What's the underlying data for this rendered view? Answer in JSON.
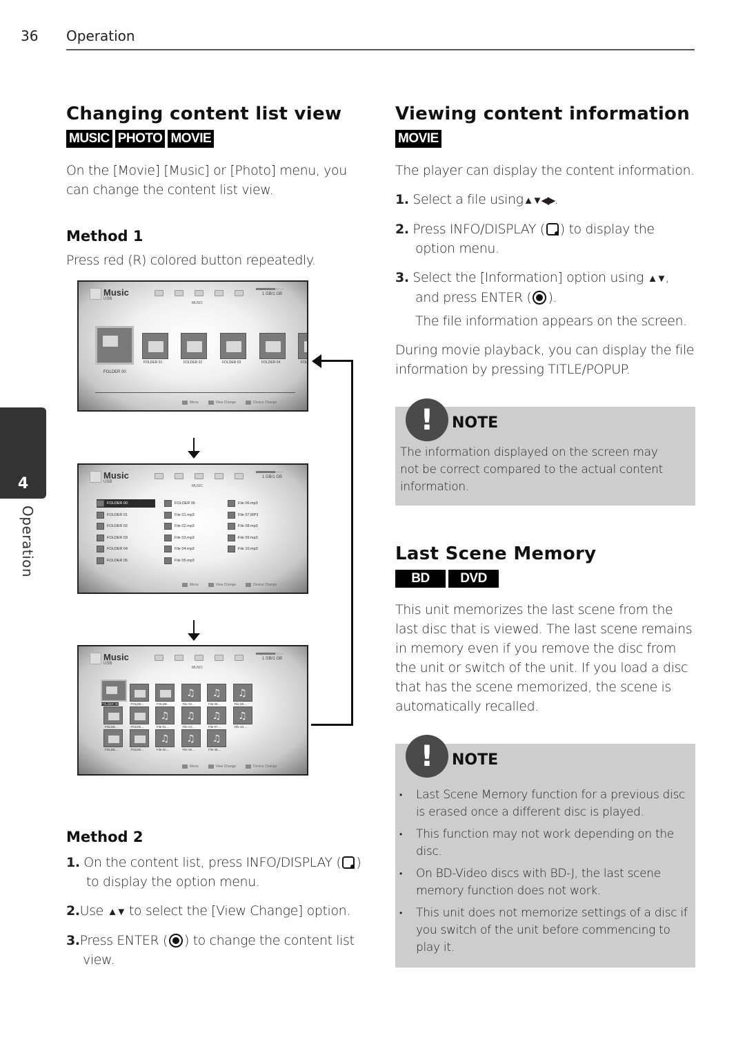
{
  "header": {
    "page_number": "36",
    "running_head": "Operation"
  },
  "side_tab": {
    "number": "4",
    "label": "Operation"
  },
  "left": {
    "title": "Changing content list view",
    "badges": [
      "MUSIC",
      "PHOTO",
      "MOVIE"
    ],
    "intro": "On the [Movie] [Music] or [Photo] menu, you can change the content list view.",
    "method1": {
      "heading": "Method 1",
      "text": "Press red (R) colored button repeatedly."
    },
    "screens": {
      "title": "Music",
      "subtitle": "USB",
      "tab_label": "MUSIC",
      "capacity": "1 GB/1 GB",
      "footer": [
        "Menu",
        "View Change",
        "Device Change"
      ],
      "screen1": {
        "tiles": [
          "FOLDER 00",
          "FOLDER 01",
          "FOLDER 02",
          "FOLDER 03",
          "FOLDER 04",
          "FOL"
        ]
      },
      "screen2": {
        "col1": [
          "FOLDER 00",
          "FOLDER 01",
          "FOLDER 02",
          "FOLDER 03",
          "FOLDER 04",
          "FOLDER 05"
        ],
        "col2": [
          "FOLDER 06",
          "File 01.mp3",
          "File 02.mp3",
          "File 03.mp3",
          "File 04.mp3",
          "File 05.mp3"
        ],
        "col3": [
          "File 06.mp3",
          "File 07.MP3",
          "File 08.mp3",
          "File 09.mp3",
          "File 10.mp3"
        ]
      },
      "screen3": {
        "row1": [
          "FOLDER 00",
          "FOLDE...",
          "FOLDE...",
          "File 03....",
          "File 06....",
          "File 09...."
        ],
        "row2": [
          "FOLDE...",
          "FOLDE...",
          "File 01....",
          "File 04....",
          "File 07....",
          "File 10...."
        ],
        "row3": [
          "FOLDE...",
          "FOLDE...",
          "File 02....",
          "File 05....",
          "File 08...."
        ]
      }
    },
    "method2": {
      "heading": "Method 2",
      "steps": [
        {
          "num": "1.",
          "pre": "On the content list, press INFO/DISPLAY (",
          "post": ")",
          "line2": "to display the option menu."
        },
        {
          "num": "2.",
          "pre": "Use ",
          "arrows": "▲▼",
          "post": " to select the [View Change] option."
        },
        {
          "num": "3.",
          "pre": "Press ENTER (",
          "post": ") to change the content list",
          "line2": "view."
        }
      ]
    }
  },
  "right": {
    "title": "Viewing content information",
    "badges": [
      "MOVIE"
    ],
    "intro": "The player can display the content information.",
    "steps": [
      {
        "num": "1.",
        "pre": "Select a file using",
        "arrows": "▲▼◀▶",
        "post": "."
      },
      {
        "num": "2.",
        "pre": "Press INFO/DISPLAY (",
        "post": ") to display the",
        "line2": "option menu."
      },
      {
        "num": "3.",
        "pre": "Select the [Information] option using ",
        "arrows": "▲▼",
        "post": ",",
        "line2_pre": "and press ENTER (",
        "line2_post": ").",
        "line3": "The file information appears on the screen."
      }
    ],
    "playback_text": "During movie playback, you can display the file information by pressing TITLE/POPUP.",
    "note1": {
      "title": "NOTE",
      "text": "The information displayed on the screen may not be correct compared to the actual content information."
    },
    "last_scene": {
      "title": "Last Scene Memory",
      "badges": [
        "BD",
        "DVD"
      ],
      "text": "This unit memorizes the last scene from the last disc that is viewed. The last scene remains in memory even if you remove the disc from the unit or switch of the unit. If you load a disc that has the scene memorized, the scene is automatically recalled."
    },
    "note2": {
      "title": "NOTE",
      "items": [
        "Last Scene Memory function for a previous disc is erased once a different disc is played.",
        "This function may not work depending on the disc.",
        "On BD-Video discs with BD-J, the last scene memory function does not work.",
        "This unit does not memorize settings of a disc if you switch of the unit before commencing to play it."
      ]
    }
  },
  "colors": {
    "note_bg": "#cdcdcd",
    "badge_bg": "#000000",
    "side_tab_bg": "#333333",
    "note_icon_bg": "#4a4a4a"
  }
}
